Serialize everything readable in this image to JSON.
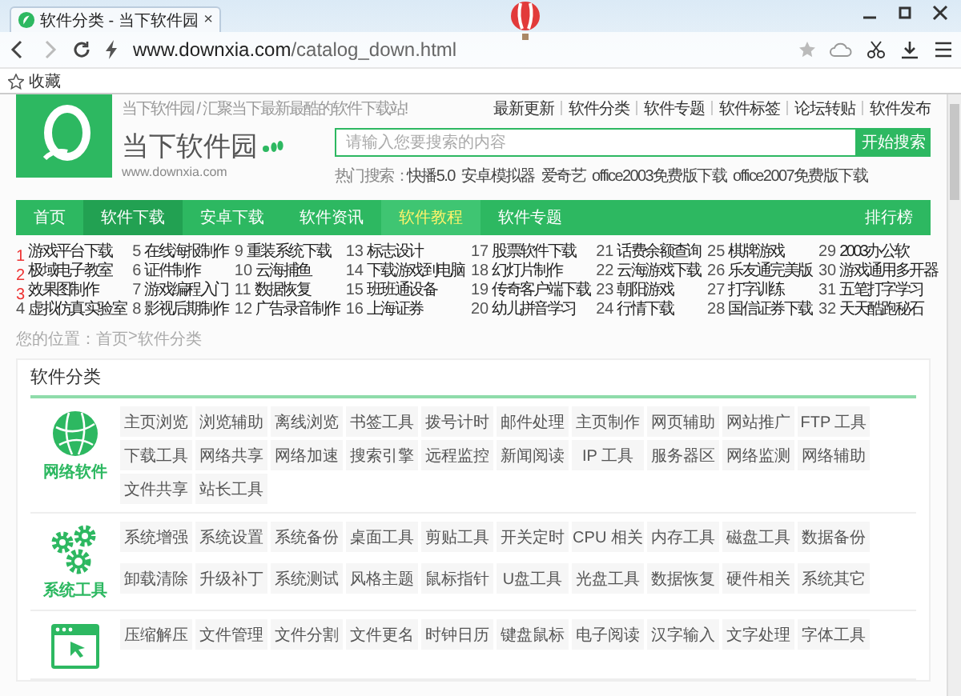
{
  "browser": {
    "tab_title": "软件分类 - 当下软件园",
    "tab_close": "×",
    "url_host": "www.downxia.com",
    "url_path": "/catalog_down.html",
    "bookmark": "收藏"
  },
  "header": {
    "tagline": "当下软件园 / 汇聚当下最新最酷的软件下载站!",
    "top_links": [
      "最新更新",
      "软件分类",
      "软件专题",
      "软件标签",
      "论坛转贴",
      "软件发布"
    ],
    "logo_name": "当下软件园",
    "logo_url": "www.downxia.com",
    "search_placeholder": "请输入您要搜索的内容",
    "search_button": "开始搜索",
    "hot_label": "热门搜索：",
    "hot_terms": [
      "快播5.0",
      "安卓模拟器",
      "爱奇艺",
      "office2003免费版下载",
      "office2007免费版下载"
    ]
  },
  "nav": {
    "items": [
      {
        "label": "首页",
        "selected": false,
        "dark": false
      },
      {
        "label": "软件下载",
        "selected": false,
        "dark": true
      },
      {
        "label": "安卓下载",
        "selected": false,
        "dark": false
      },
      {
        "label": "软件资讯",
        "selected": false,
        "dark": false
      },
      {
        "label": "软件教程",
        "selected": true,
        "dark": false
      },
      {
        "label": "软件专题",
        "selected": false,
        "dark": false
      }
    ],
    "right": "排行榜"
  },
  "ranks": [
    {
      "num": "1",
      "label": "游戏平台下载",
      "hot": true
    },
    {
      "num": "2",
      "label": "极域电子教室",
      "hot": true
    },
    {
      "num": "3",
      "label": "效果图制作",
      "hot": true
    },
    {
      "num": "4",
      "label": "虚拟仿真实验室",
      "hot": false
    },
    {
      "num": "5",
      "label": "在线海报制作",
      "hot": false
    },
    {
      "num": "6",
      "label": "证件制作",
      "hot": false
    },
    {
      "num": "7",
      "label": "游戏编程入门",
      "hot": false
    },
    {
      "num": "8",
      "label": "影视后期制作",
      "hot": false
    },
    {
      "num": "9",
      "label": "重装系统下载",
      "hot": false
    },
    {
      "num": "10",
      "label": "云海捕鱼",
      "hot": false
    },
    {
      "num": "11",
      "label": "数据恢复",
      "hot": false
    },
    {
      "num": "12",
      "label": "广告录音制作",
      "hot": false
    },
    {
      "num": "13",
      "label": "标志设计",
      "hot": false
    },
    {
      "num": "14",
      "label": "下载游戏到电脑",
      "hot": false
    },
    {
      "num": "15",
      "label": "班班通设备",
      "hot": false
    },
    {
      "num": "16",
      "label": "上海证券",
      "hot": false
    },
    {
      "num": "17",
      "label": "股票软件下载",
      "hot": false
    },
    {
      "num": "18",
      "label": "幻灯片制作",
      "hot": false
    },
    {
      "num": "19",
      "label": "传奇客户端下载",
      "hot": false
    },
    {
      "num": "20",
      "label": "幼儿拼音学习",
      "hot": false
    },
    {
      "num": "21",
      "label": "话费余额查询",
      "hot": false
    },
    {
      "num": "22",
      "label": "云海游戏下载",
      "hot": false
    },
    {
      "num": "23",
      "label": "朝阳游戏",
      "hot": false
    },
    {
      "num": "24",
      "label": "行情下载",
      "hot": false
    },
    {
      "num": "25",
      "label": "棋牌游戏",
      "hot": false
    },
    {
      "num": "26",
      "label": "乐友通完美版",
      "hot": false
    },
    {
      "num": "27",
      "label": "打字训练",
      "hot": false
    },
    {
      "num": "28",
      "label": "国信证券下载",
      "hot": false
    },
    {
      "num": "29",
      "label": "2003办公软",
      "hot": false
    },
    {
      "num": "30",
      "label": "游戏通用多开器",
      "hot": false
    },
    {
      "num": "31",
      "label": "五笔打字学习",
      "hot": false
    },
    {
      "num": "32",
      "label": "天天酷跑秘石",
      "hot": false
    }
  ],
  "breadcrumb": {
    "label": "您的位置：",
    "home": "首页",
    "separator": ">",
    "current": "软件分类"
  },
  "section_title": "软件分类",
  "categories": [
    {
      "kind": "globe",
      "name": "网络软件",
      "tags": [
        "主页浏览",
        "浏览辅助",
        "离线浏览",
        "书签工具",
        "拨号计时",
        "邮件处理",
        "主页制作",
        "网页辅助",
        "网站推广",
        "FTP 工具",
        "下载工具",
        "网络共享",
        "网络加速",
        "搜索引擎",
        "远程监控",
        "新闻阅读",
        "IP 工具",
        "服务器区",
        "网络监测",
        "网络辅助",
        "文件共享",
        "站长工具"
      ]
    },
    {
      "kind": "gears",
      "name": "系统工具",
      "tags": [
        "系统增强",
        "系统设置",
        "系统备份",
        "桌面工具",
        "剪贴工具",
        "开关定时",
        "CPU 相关",
        "内存工具",
        "磁盘工具",
        "数据备份",
        "卸载清除",
        "升级补丁",
        "系统测试",
        "风格主题",
        "鼠标指针",
        "U盘工具",
        "光盘工具",
        "数据恢复",
        "硬件相关",
        "系统其它"
      ]
    },
    {
      "kind": "window",
      "tags": [
        "压缩解压",
        "文件管理",
        "文件分割",
        "文件更名",
        "时钟日历",
        "键盘鼠标",
        "电子阅读",
        "汉字输入",
        "文字处理",
        "字体工具"
      ]
    }
  ]
}
